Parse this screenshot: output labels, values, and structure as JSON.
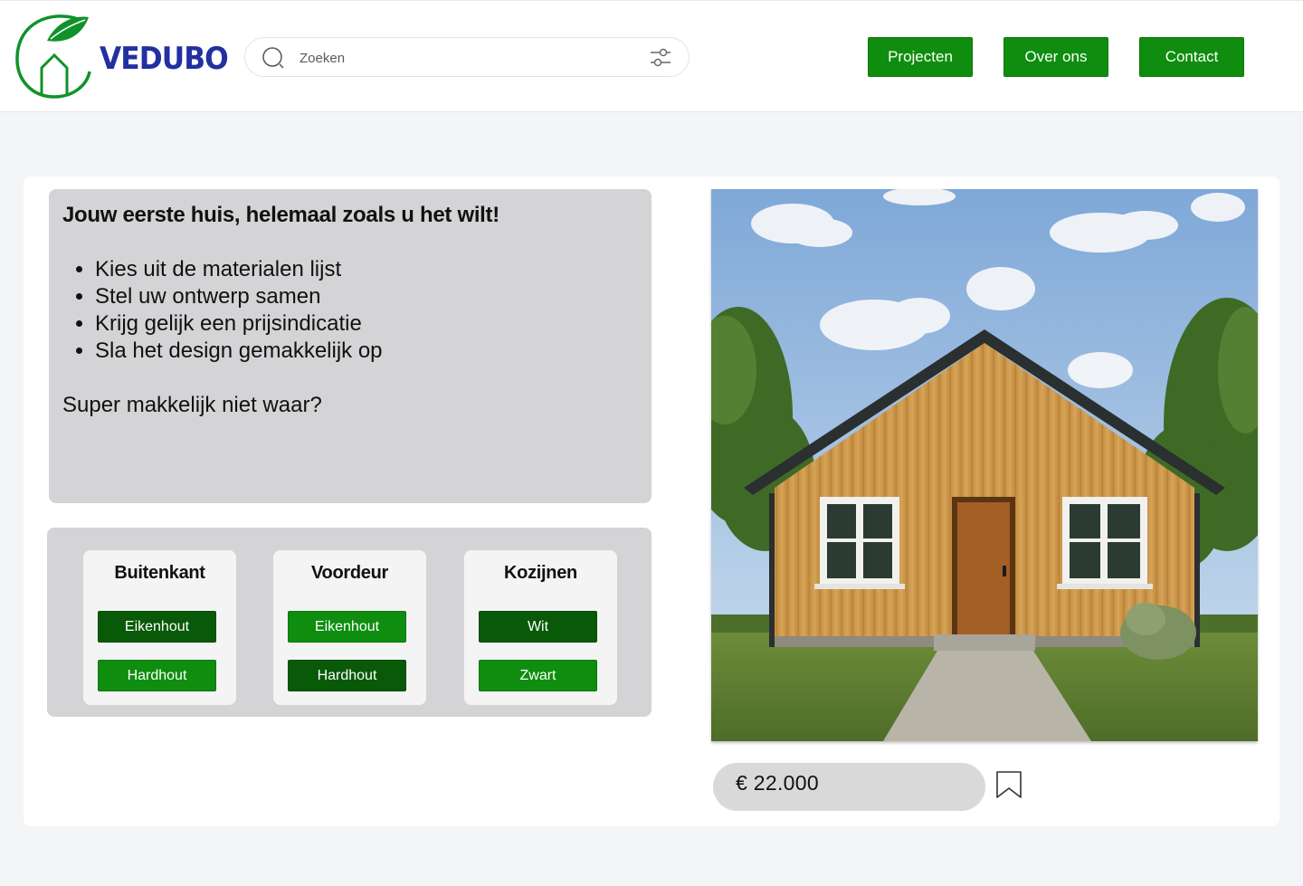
{
  "header": {
    "logo_text": "VEDUBO",
    "search": {
      "placeholder": "Zoeken",
      "value": ""
    },
    "nav": [
      "Projecten",
      "Over ons",
      "Contact"
    ]
  },
  "intro": {
    "title": "Jouw eerste huis, helemaal zoals u het wilt!",
    "bullets": [
      "Kies uit de materialen lijst",
      "Stel uw ontwerp samen",
      "Krijg gelijk een prijsindicatie",
      "Sla het design gemakkelijk op"
    ],
    "closing": "Super makkelijk niet waar?"
  },
  "options": [
    {
      "title": "Buitenkant",
      "choices": [
        {
          "label": "Eikenhout",
          "selected": true
        },
        {
          "label": "Hardhout",
          "selected": false
        }
      ]
    },
    {
      "title": "Voordeur",
      "choices": [
        {
          "label": "Eikenhout",
          "selected": false
        },
        {
          "label": "Hardhout",
          "selected": true
        }
      ]
    },
    {
      "title": "Kozijnen",
      "choices": [
        {
          "label": "Wit",
          "selected": true
        },
        {
          "label": "Zwart",
          "selected": false
        }
      ]
    }
  ],
  "price": "€ 22.000",
  "icons": {
    "search": "search-icon",
    "filter": "filter-sliders-icon",
    "bookmark": "bookmark-icon",
    "logo": "leaf-house-logo-icon"
  },
  "colors": {
    "brand_green": "#0e8d0e",
    "selected_green": "#085908",
    "logo_blue": "#2330a0",
    "panel_grey": "#d4d3d5"
  }
}
